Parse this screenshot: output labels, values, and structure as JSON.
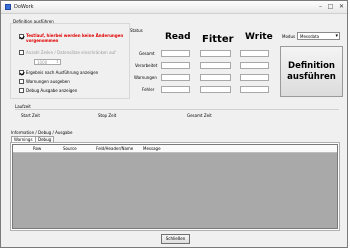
{
  "window": {
    "title": "DoWork"
  },
  "definition": {
    "group_label": "Definition ausführen",
    "test_run_label": "Testlauf, hierbei werden keine Änderungen vorgenommen",
    "show_lines_label": "Anzahl Zeilen / Datensätze einschränken auf",
    "show_lines_value": "1000",
    "show_results_label": "Ergebnis nach Ausführung anzeigen",
    "warnings_label": "Warnungen ausgeben",
    "debug_label": "Debug Ausgabe anzeigen"
  },
  "status": {
    "label": "Status",
    "col_read": "Read",
    "col_filter": "Fitter",
    "col_write": "Write",
    "rows": [
      "Gesamt",
      "Verarbeitet",
      "Warnungen",
      "Fehler"
    ]
  },
  "modus": {
    "label": "Modus",
    "value": "Messdata"
  },
  "run_button": {
    "line1": "Definition",
    "line2": "ausführen"
  },
  "laufzeit": {
    "label": "Laufzeit",
    "start": "Start Zeit",
    "stop": "Stop Zeit",
    "total": "Gesamt Zeit"
  },
  "info": {
    "label": "Information / Debug / Ausgabe",
    "tabs": [
      "Warnings",
      "Debug"
    ],
    "columns": [
      "Row",
      "Source",
      "Feld/Header/Name",
      "Message"
    ]
  },
  "close_button": "Schließen",
  "icons": {
    "app": "app-icon",
    "minimize": "minimize-icon",
    "maximize": "maximize-icon",
    "close": "close-icon"
  }
}
